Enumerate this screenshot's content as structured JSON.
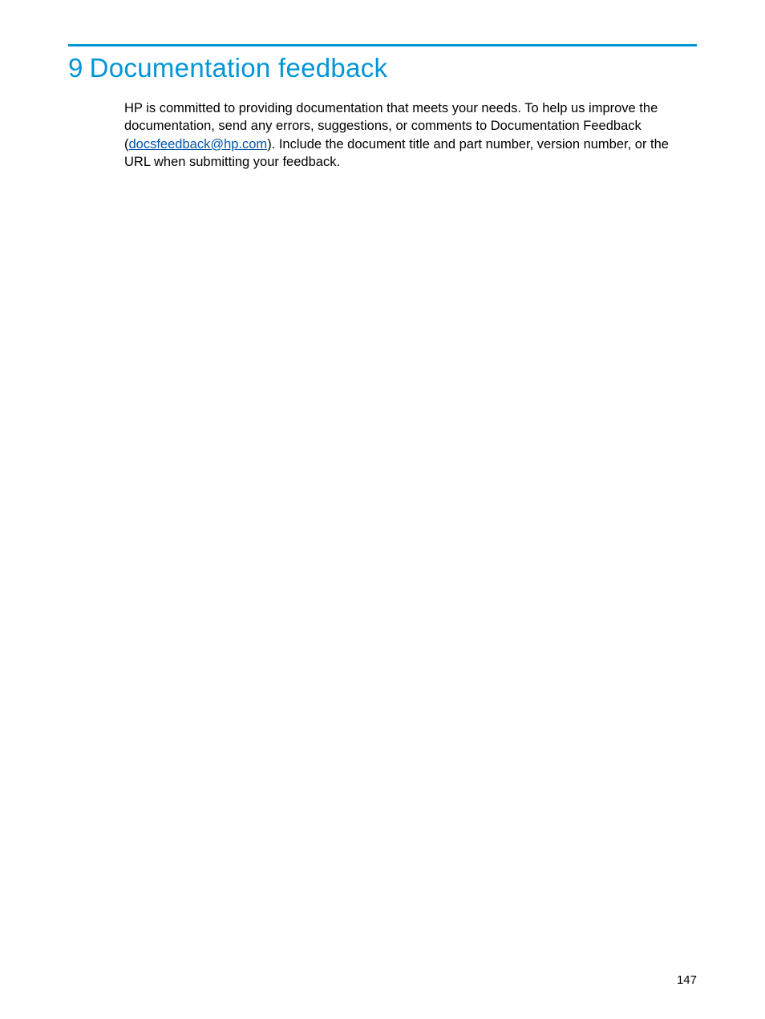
{
  "chapter": {
    "number": "9",
    "title": "Documentation feedback"
  },
  "body": {
    "text_before_link": "HP is committed to providing documentation that meets your needs. To help us improve the documentation, send any errors, suggestions, or comments to Documentation Feedback (",
    "link_text": "docsfeedback@hp.com",
    "text_after_link": "). Include the document title and part number, version number, or the URL when submitting your feedback."
  },
  "page_number": "147",
  "colors": {
    "accent": "#0096d6",
    "link": "#0054a6"
  }
}
